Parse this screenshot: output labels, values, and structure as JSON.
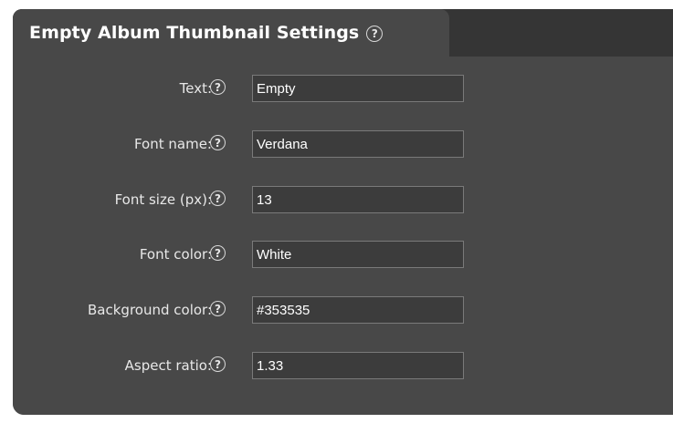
{
  "panel": {
    "title": "Empty Album Thumbnail Settings",
    "help_glyph": "?"
  },
  "fields": [
    {
      "label": "Text:",
      "value": "Empty"
    },
    {
      "label": "Font name:",
      "value": "Verdana"
    },
    {
      "label": "Font size (px):",
      "value": "13"
    },
    {
      "label": "Font color:",
      "value": "White"
    },
    {
      "label": "Background color:",
      "value": "#353535"
    },
    {
      "label": "Aspect ratio:",
      "value": "1.33"
    }
  ],
  "colors": {
    "panel_background": "#484848",
    "outer_background": "#353535",
    "input_border": "#7a7a7a",
    "text": "#ffffff"
  }
}
